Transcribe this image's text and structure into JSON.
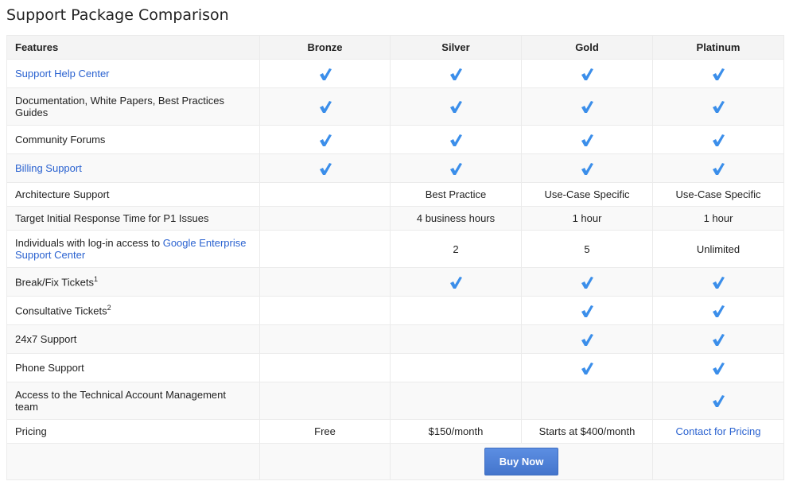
{
  "title": "Support Package Comparison",
  "colors": {
    "link": "#2a62d0",
    "check": "#3b8eea",
    "button": "#4d7fd8"
  },
  "headers": [
    "Features",
    "Bronze",
    "Silver",
    "Gold",
    "Platinum"
  ],
  "rows": [
    {
      "feature": "Support Help Center",
      "link": true,
      "cells": [
        "check",
        "check",
        "check",
        "check"
      ]
    },
    {
      "feature": "Documentation, White Papers, Best Practices Guides",
      "cells": [
        "check",
        "check",
        "check",
        "check"
      ]
    },
    {
      "feature": "Community Forums",
      "cells": [
        "check",
        "check",
        "check",
        "check"
      ]
    },
    {
      "feature": "Billing Support",
      "link": true,
      "cells": [
        "check",
        "check",
        "check",
        "check"
      ]
    },
    {
      "feature": "Architecture Support",
      "cells": [
        "",
        "Best Practice",
        "Use-Case Specific",
        "Use-Case Specific"
      ]
    },
    {
      "feature": "Target Initial Response Time for P1 Issues",
      "cells": [
        "",
        "4 business hours",
        "1 hour",
        "1 hour"
      ]
    },
    {
      "feature": "Individuals with log-in access to ",
      "feature_link": "Google Enterprise Support Center",
      "cells": [
        "",
        "2",
        "5",
        "Unlimited"
      ]
    },
    {
      "feature": "Break/Fix Tickets",
      "sup": "1",
      "cells": [
        "",
        "check",
        "check",
        "check"
      ]
    },
    {
      "feature": "Consultative Tickets",
      "sup": "2",
      "cells": [
        "",
        "",
        "check",
        "check"
      ]
    },
    {
      "feature": "24x7 Support",
      "cells": [
        "",
        "",
        "check",
        "check"
      ]
    },
    {
      "feature": "Phone Support",
      "cells": [
        "",
        "",
        "check",
        "check"
      ]
    },
    {
      "feature": "Access to the Technical Account Management team",
      "cells": [
        "",
        "",
        "",
        "check"
      ]
    },
    {
      "feature": "Pricing",
      "cells": [
        "Free",
        "$150/month",
        "Starts at $400/month",
        "Contact for Pricing"
      ],
      "last_link": true
    }
  ],
  "buy_now": "Buy Now"
}
